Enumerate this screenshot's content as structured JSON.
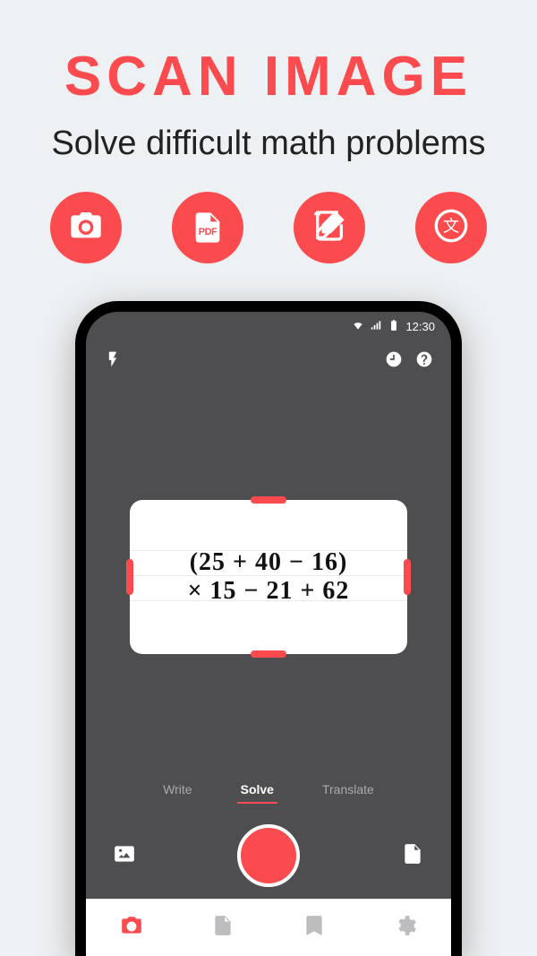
{
  "hero": {
    "title": "SCAN IMAGE",
    "subtitle": "Solve difficult math problems"
  },
  "features": {
    "items": [
      {
        "icon": "camera-icon"
      },
      {
        "icon": "pdf-icon",
        "badge": "PDF"
      },
      {
        "icon": "edit-icon"
      },
      {
        "icon": "translate-icon"
      }
    ]
  },
  "phone": {
    "status": {
      "time": "12:30"
    },
    "scan": {
      "line1": "(25 + 40 − 16)",
      "line2": "× 15 − 21 + 62"
    },
    "modes": {
      "write": "Write",
      "solve": "Solve",
      "translate": "Translate",
      "active": "solve"
    }
  },
  "colors": {
    "accent": "#FC4B4F"
  }
}
